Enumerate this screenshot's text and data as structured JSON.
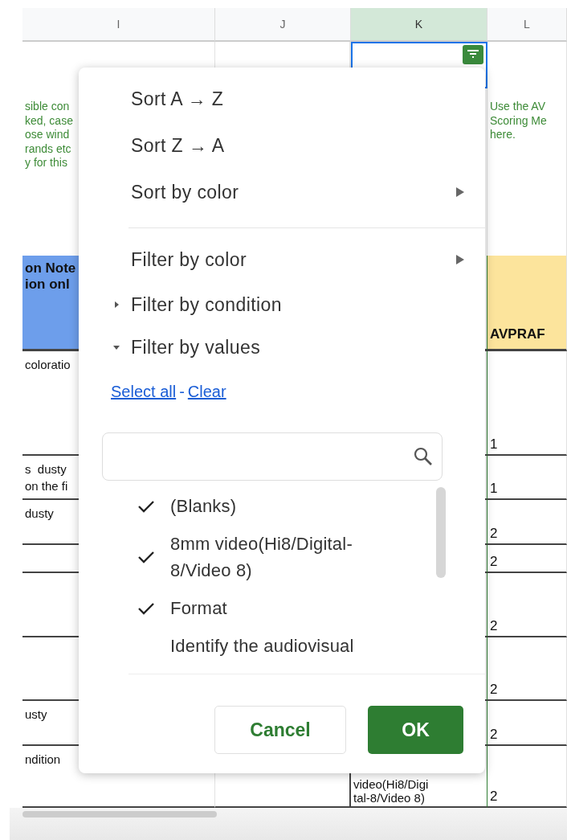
{
  "columns": [
    {
      "label": "I",
      "selected": false
    },
    {
      "label": "J",
      "selected": false
    },
    {
      "label": "K",
      "selected": true
    },
    {
      "label": "L",
      "selected": false
    }
  ],
  "rows": [
    {
      "kind": "blank",
      "cells": [
        {},
        {},
        {
          "filter": true
        },
        {}
      ]
    },
    {
      "kind": "note",
      "cells": [
        {
          "lines": [
            "sible con",
            "ked, case",
            "ose wind",
            "rands etc",
            "y for this"
          ]
        },
        {},
        {},
        {
          "lines": [
            "Use the AV",
            "Scoring Me",
            "here."
          ]
        }
      ]
    },
    {
      "kind": "header",
      "cells": [
        {
          "lines": [
            "on Note",
            "ion onl"
          ],
          "color": "#6d9eeb"
        },
        {},
        {},
        {
          "lines": [
            "AVPRAF"
          ],
          "color": "#fce49c"
        }
      ]
    },
    {
      "kind": "data",
      "cells": [
        {
          "lines": [
            "coloratio"
          ]
        },
        {},
        {},
        {
          "lines": [
            "1"
          ]
        }
      ]
    },
    {
      "kind": "data",
      "cells": [
        {
          "lines": [
            "s  dusty",
            "on the fi"
          ]
        },
        {},
        {},
        {
          "lines": [
            "1"
          ]
        }
      ]
    },
    {
      "kind": "data",
      "cells": [
        {
          "lines": [
            "dusty"
          ]
        },
        {},
        {},
        {
          "lines": [
            "2"
          ]
        }
      ]
    },
    {
      "kind": "data",
      "cells": [
        {},
        {},
        {},
        {
          "lines": [
            "2"
          ]
        }
      ]
    },
    {
      "kind": "data",
      "cells": [
        {},
        {},
        {},
        {
          "lines": [
            "2"
          ]
        }
      ]
    },
    {
      "kind": "data",
      "cells": [
        {},
        {},
        {},
        {
          "lines": [
            "2"
          ]
        }
      ]
    },
    {
      "kind": "data",
      "cells": [
        {
          "lines": [
            "usty"
          ]
        },
        {},
        {},
        {
          "lines": [
            "2"
          ]
        }
      ]
    },
    {
      "kind": "data",
      "cells": [
        {
          "lines": [
            "ndition"
          ]
        },
        {},
        {
          "lines": [
            "video(Hi8/Digi",
            "tal-8/Video 8)"
          ]
        },
        {
          "lines": [
            "2"
          ]
        }
      ]
    }
  ],
  "filter_menu": {
    "sort_items": [
      {
        "label": "Sort A → Z",
        "kind": "action"
      },
      {
        "label": "Sort Z → A",
        "kind": "action"
      },
      {
        "label": "Sort by color",
        "kind": "submenu"
      }
    ],
    "filter_items": [
      {
        "label": "Filter by color",
        "kind": "submenu"
      },
      {
        "label": "Filter by condition",
        "kind": "section",
        "expanded": false
      },
      {
        "label": "Filter by values",
        "kind": "section",
        "expanded": true
      }
    ],
    "select_all": "Select all",
    "separator": "-",
    "clear": "Clear",
    "values": [
      {
        "label": "(Blanks)",
        "checked": true
      },
      {
        "label": "8mm video(Hi8/Digital-8/Video 8)",
        "checked": true
      },
      {
        "label": "Format",
        "checked": true
      },
      {
        "label": "Identify the audiovisual",
        "checked": false
      }
    ],
    "buttons": [
      {
        "label": "Cancel",
        "kind": "secondary"
      },
      {
        "label": "OK",
        "kind": "primary"
      }
    ]
  }
}
